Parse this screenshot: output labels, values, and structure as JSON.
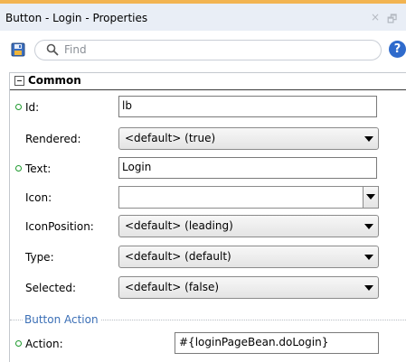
{
  "window": {
    "title": "Button - Login - Properties",
    "close_glyph": "×",
    "restore_glyph": "🗗"
  },
  "toolbar": {
    "save_icon": "save-icon",
    "search_placeholder": "Find",
    "help_label": "?"
  },
  "section": {
    "title": "Common"
  },
  "fields": {
    "id": {
      "label": "Id:",
      "value": "lb",
      "required": true
    },
    "rendered": {
      "label": "Rendered:",
      "value": "<default> (true)"
    },
    "text": {
      "label": "Text:",
      "value": "Login",
      "required": true
    },
    "icon": {
      "label": "Icon:",
      "value": ""
    },
    "icon_position": {
      "label": "IconPosition:",
      "value": "<default> (leading)"
    },
    "type": {
      "label": "Type:",
      "value": "<default> (default)"
    },
    "selected": {
      "label": "Selected:",
      "value": "<default> (false)"
    }
  },
  "subsection": {
    "title": "Button Action"
  },
  "action": {
    "label": "Action:",
    "value": "#{loginPageBean.doLogin}",
    "required": true
  },
  "colors": {
    "required_dot": "#1f9a2e",
    "subsection_title": "#3b6fb6",
    "help_icon": "#2f6bcc",
    "title_bar": "#e9eef6"
  }
}
